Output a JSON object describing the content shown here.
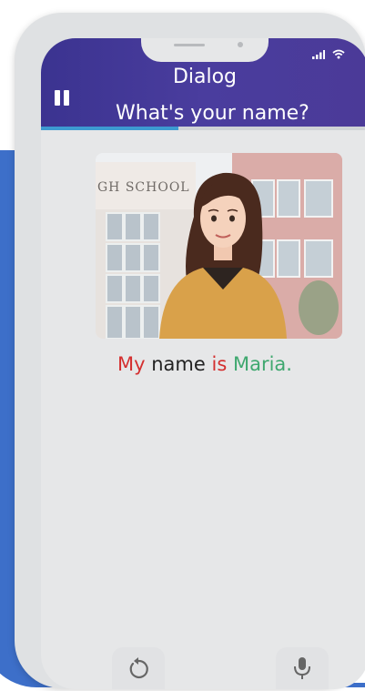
{
  "status": {
    "signal_icon": "signal-icon",
    "wifi_icon": "wifi-icon"
  },
  "header": {
    "title": "Dialog",
    "subtitle": "What's your name?",
    "pause_icon": "pause-icon",
    "background_color": "#4a3d9e"
  },
  "progress": {
    "value": 0.42,
    "color": "#3d9ad1"
  },
  "scene": {
    "sign_text": "GH SCHOOL"
  },
  "sentence": {
    "words": [
      {
        "text": "My",
        "color": "#d42f2f"
      },
      {
        "text": "name",
        "color": "#222222"
      },
      {
        "text": "is",
        "color": "#d42f2f"
      },
      {
        "text": "Maria.",
        "color": "#3fa86f"
      }
    ]
  },
  "controls": {
    "replay_icon": "replay-icon",
    "mic_icon": "microphone-icon"
  }
}
